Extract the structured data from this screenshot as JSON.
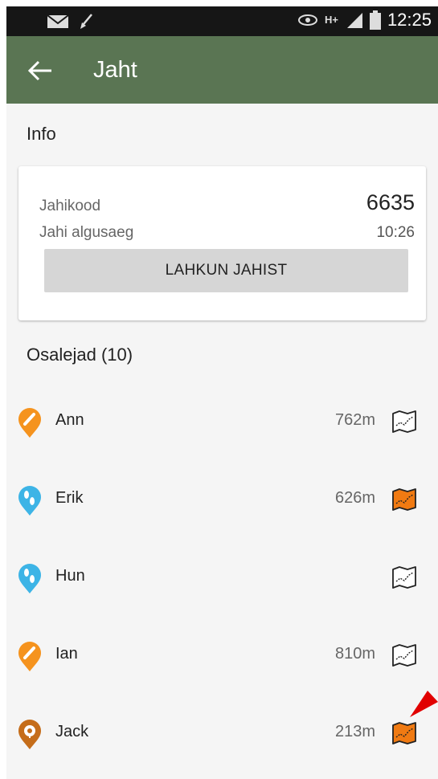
{
  "status_bar": {
    "time": "12:25",
    "network": "H+"
  },
  "app_bar": {
    "title": "Jaht"
  },
  "info": {
    "section_title": "Info",
    "hunt_code_label": "Jahikood",
    "hunt_code": "6635",
    "start_time_label": "Jahi algusaeg",
    "start_time": "10:26",
    "leave_button": "LAHKUN JAHIST"
  },
  "participants": {
    "section_title": "Osalejad (10)",
    "items": [
      {
        "name": "Ann",
        "distance": "762m",
        "pin_color": "#f5931e",
        "pin_icon": "pen-pin-icon",
        "map_active": false
      },
      {
        "name": "Erik",
        "distance": "626m",
        "pin_color": "#3db4e6",
        "pin_icon": "footprints-pin-icon",
        "map_active": true
      },
      {
        "name": "Hun",
        "distance": "",
        "pin_color": "#3db4e6",
        "pin_icon": "footprints-pin-icon",
        "map_active": false
      },
      {
        "name": "Ian",
        "distance": "810m",
        "pin_color": "#f5931e",
        "pin_icon": "pen-pin-icon",
        "map_active": false
      },
      {
        "name": "Jack",
        "distance": "213m",
        "pin_color": "#c56d1a",
        "pin_icon": "target-pin-icon",
        "map_active": true
      }
    ]
  },
  "colors": {
    "app_bar": "#5a7553",
    "status_bar": "#161616",
    "map_active": "#f07a12",
    "annotation_arrow": "#e10000"
  }
}
